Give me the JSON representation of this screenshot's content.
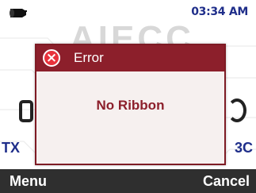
{
  "status_bar": {
    "time": "03:34 AM",
    "printer_icon": "printer-icon"
  },
  "background": {
    "left_text": "TX",
    "right_text": "3C"
  },
  "dialog": {
    "title": "Error",
    "icon": "error-x-icon",
    "message": "No Ribbon"
  },
  "softkeys": {
    "left": "Menu",
    "right": "Cancel"
  },
  "colors": {
    "header": "#8c1f2b",
    "message": "#8c1f2b",
    "clock": "#1f2e8a",
    "softkey_bar": "#2f2f2f",
    "error_icon": "#e8323c"
  }
}
